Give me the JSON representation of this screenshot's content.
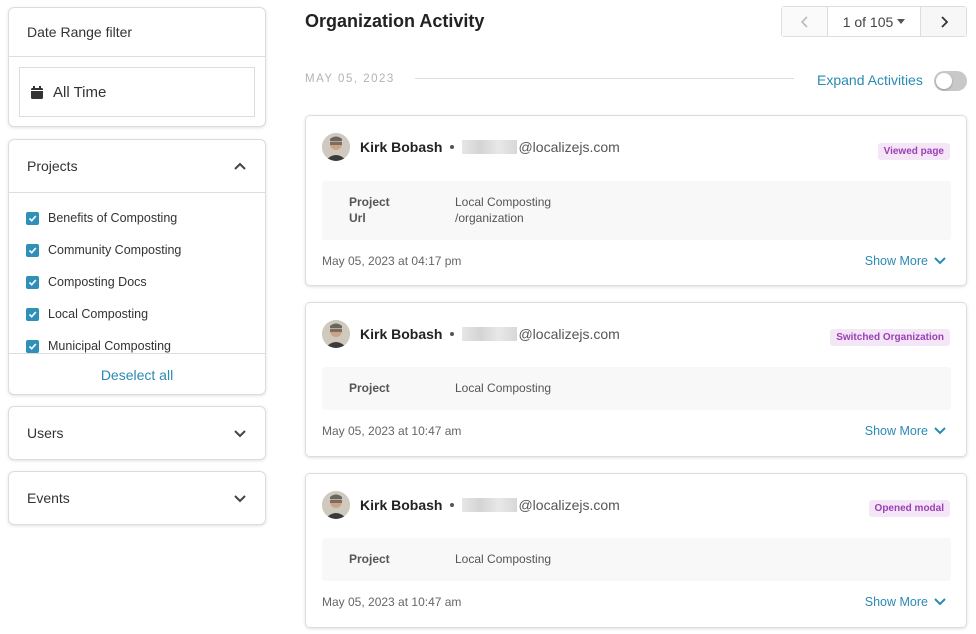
{
  "sidebar": {
    "date_filter": {
      "title": "Date Range filter",
      "value": "All Time",
      "icon": "calendar-icon"
    },
    "projects": {
      "title": "Projects",
      "items": [
        {
          "label": "Benefits of Composting",
          "checked": true
        },
        {
          "label": "Community Composting",
          "checked": true
        },
        {
          "label": "Composting Docs",
          "checked": true
        },
        {
          "label": "Local Composting",
          "checked": true
        },
        {
          "label": "Municipal Composting",
          "checked": true
        }
      ],
      "deselect_label": "Deselect all"
    },
    "users": {
      "title": "Users"
    },
    "events": {
      "title": "Events"
    }
  },
  "main": {
    "title": "Organization Activity",
    "pager": {
      "label": "1 of 105"
    },
    "date_group": "MAY 05, 2023",
    "expand_label": "Expand Activities",
    "expand_enabled": false,
    "activities": [
      {
        "user": "Kirk Bobash",
        "email_domain": "@localizejs.com",
        "badge": "Viewed page",
        "details": [
          {
            "key": "Project",
            "value": "Local Composting"
          },
          {
            "key": "Url",
            "value": "/organization"
          }
        ],
        "timestamp": "May 05, 2023 at 04:17 pm",
        "show_more": "Show More"
      },
      {
        "user": "Kirk Bobash",
        "email_domain": "@localizejs.com",
        "badge": "Switched Organization",
        "details": [
          {
            "key": "Project",
            "value": "Local Composting"
          }
        ],
        "timestamp": "May 05, 2023 at 10:47 am",
        "show_more": "Show More"
      },
      {
        "user": "Kirk Bobash",
        "email_domain": "@localizejs.com",
        "badge": "Opened modal",
        "details": [
          {
            "key": "Project",
            "value": "Local Composting"
          }
        ],
        "timestamp": "May 05, 2023 at 10:47 am",
        "show_more": "Show More"
      }
    ]
  },
  "colors": {
    "accent": "#2a8ab3",
    "checkbox": "#2e8fb8",
    "badge_bg": "#f4e6f7",
    "badge_text": "#9a3fb5"
  }
}
